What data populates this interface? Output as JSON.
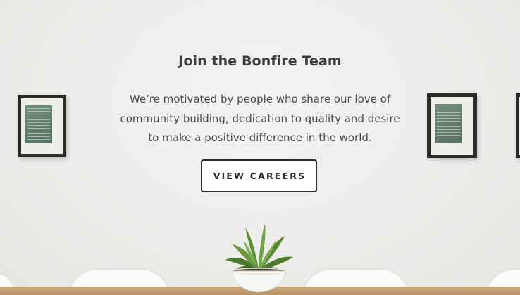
{
  "hero": {
    "title": "Join the Bonfire Team",
    "description": "We’re motivated by people who share our love of community building, dedication to quality and desire to make a positive difference in the world.",
    "cta_label": "VIEW CAREERS"
  },
  "colors": {
    "wall": "#eeeeec",
    "text_dark": "#3c3d40",
    "button_border": "#2b2b2d",
    "print_green": "#5d7d6b",
    "table_wood": "#b98f62"
  },
  "icons": {
    "plant": "potted-plant-icon"
  }
}
